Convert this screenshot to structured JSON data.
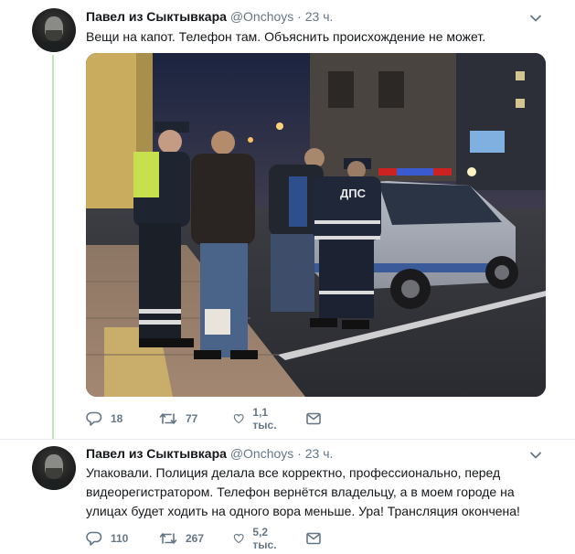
{
  "tweets": [
    {
      "author": {
        "name": "Павел из Сыктывкара",
        "handle": "@Onchoys"
      },
      "separator": "·",
      "time": "23 ч.",
      "text": "Вещи на капот. Телефон там. Объяснить происхождение не может.",
      "media": {
        "vehicle_text": "ДПС"
      },
      "actions": {
        "replies": "18",
        "retweets": "77",
        "likes": "1,1 тыс."
      },
      "icons": [
        "reply-icon",
        "retweet-icon",
        "heart-icon",
        "message-icon",
        "chevron-down-icon"
      ]
    },
    {
      "author": {
        "name": "Павел из Сыктывкара",
        "handle": "@Onchoys"
      },
      "separator": "·",
      "time": "23 ч.",
      "text_lines": [
        "Упаковали. Полиция делала все корректно, профессионально, перед",
        "видеорегистратором. Телефон вернётся владельцу, а в моем городе на",
        "улицах будет ходить на одного вора меньше. Ура! Трансляция окончена!"
      ],
      "actions": {
        "replies": "110",
        "retweets": "267",
        "likes": "5,2 тыс."
      },
      "icons": [
        "reply-icon",
        "retweet-icon",
        "heart-icon",
        "message-icon",
        "chevron-down-icon"
      ]
    }
  ],
  "colors": {
    "text": "#14171a",
    "secondary": "#657786",
    "thread_line": "#c4e5b8",
    "divider": "#e6ecf0"
  }
}
